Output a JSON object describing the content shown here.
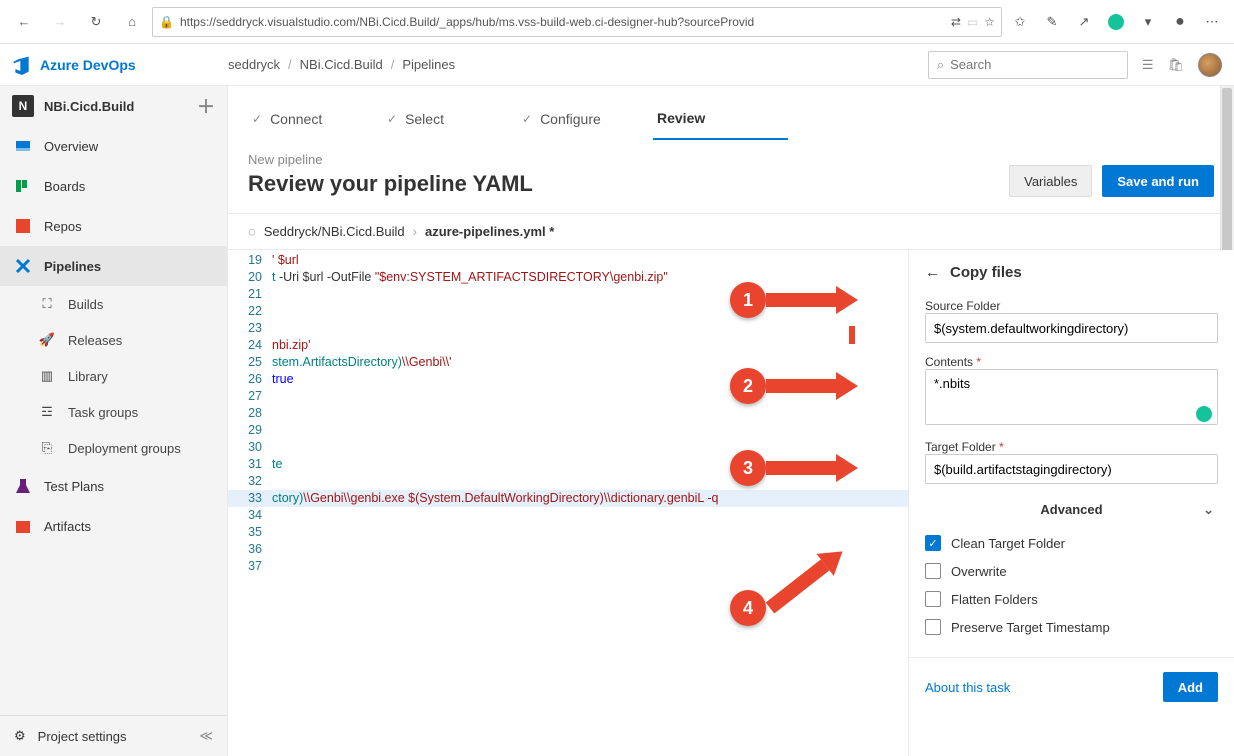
{
  "browser": {
    "url": "https://seddryck.visualstudio.com/NBi.Cicd.Build/_apps/hub/ms.vss-build-web.ci-designer-hub?sourceProvid"
  },
  "brand": "Azure DevOps",
  "breadcrumb": {
    "org": "seddryck",
    "project": "NBi.Cicd.Build",
    "section": "Pipelines"
  },
  "search_placeholder": "Search",
  "project": {
    "initial": "N",
    "name": "NBi.Cicd.Build"
  },
  "sidebar": {
    "items": [
      {
        "label": "Overview"
      },
      {
        "label": "Boards"
      },
      {
        "label": "Repos"
      },
      {
        "label": "Pipelines"
      }
    ],
    "subitems": [
      {
        "label": "Builds"
      },
      {
        "label": "Releases"
      },
      {
        "label": "Library"
      },
      {
        "label": "Task groups"
      },
      {
        "label": "Deployment groups"
      }
    ],
    "bottom": [
      {
        "label": "Test Plans"
      },
      {
        "label": "Artifacts"
      }
    ],
    "settings": "Project settings"
  },
  "wizard": {
    "steps": [
      {
        "label": "Connect"
      },
      {
        "label": "Select"
      },
      {
        "label": "Configure"
      },
      {
        "label": "Review"
      }
    ],
    "subtitle": "New pipeline",
    "title": "Review your pipeline YAML",
    "variables_btn": "Variables",
    "save_btn": "Save and run"
  },
  "file": {
    "repo": "Seddryck/NBi.Cicd.Build",
    "name": "azure-pipelines.yml *"
  },
  "code": {
    "start": 19,
    "lines": [
      {
        "html": "<span class='str'>' $url</span>"
      },
      {
        "html": "<span class='var'>t</span> -Uri $url -OutFile <span class='str'>\"$env:SYSTEM_ARTIFACTSDIRECTORY\\genbi.zip\"</span>"
      },
      {
        "html": ""
      },
      {
        "html": ""
      },
      {
        "html": ""
      },
      {
        "html": "<span class='str'>nbi.zip'</span>"
      },
      {
        "html": "<span class='var'>stem.ArtifactsDirectory)</span><span class='str'>\\\\Genbi\\\\'</span>"
      },
      {
        "html": "<span class='kw'>true</span>"
      },
      {
        "html": ""
      },
      {
        "html": ""
      },
      {
        "html": ""
      },
      {
        "html": ""
      },
      {
        "html": "<span class='var'>te</span>"
      },
      {
        "html": ""
      },
      {
        "html": "<span class='var'>ctory)</span><span class='str'>\\\\Genbi\\\\genbi.exe $(System.DefaultWorkingDirectory)\\\\dictionary.genbiL -q</span>",
        "sel": true
      },
      {
        "html": ""
      },
      {
        "html": ""
      },
      {
        "html": ""
      },
      {
        "html": ""
      }
    ]
  },
  "panel": {
    "title": "Copy files",
    "source_label": "Source Folder",
    "source_value": "$(system.defaultworkingdirectory)",
    "contents_label": "Contents",
    "contents_value": "*.nbits",
    "target_label": "Target Folder",
    "target_value": "$(build.artifactstagingdirectory)",
    "advanced": "Advanced",
    "checks": [
      {
        "label": "Clean Target Folder",
        "checked": true
      },
      {
        "label": "Overwrite",
        "checked": false
      },
      {
        "label": "Flatten Folders",
        "checked": false
      },
      {
        "label": "Preserve Target Timestamp",
        "checked": false
      }
    ],
    "about": "About this task",
    "add": "Add"
  },
  "annotations": [
    "1",
    "2",
    "3",
    "4"
  ]
}
